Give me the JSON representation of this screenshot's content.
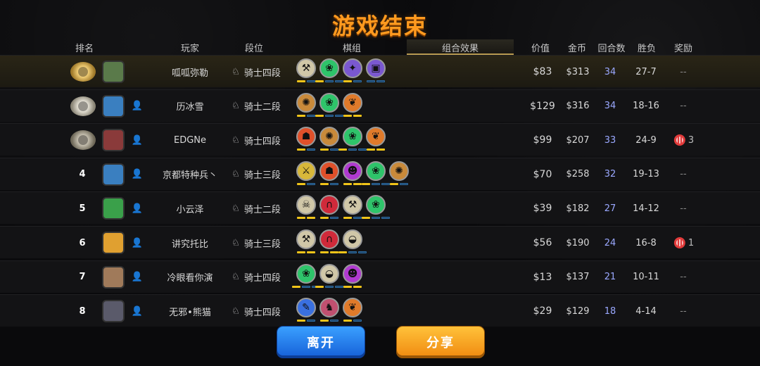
{
  "title": "游戏结束",
  "headers": {
    "rank": "排名",
    "player": "玩家",
    "tier": "段位",
    "comp": "棋组",
    "synergy": "组合效果",
    "value": "价值",
    "gold": "金币",
    "rounds": "回合数",
    "winloss": "胜负",
    "reward": "奖励"
  },
  "colors": {
    "title": "#ff9a1f",
    "active_tab_underline": "#b89a50",
    "rounds_text": "#9aa8ff",
    "leave_button": "#1660d8",
    "share_button": "#f08a10"
  },
  "rows": [
    {
      "rank": "",
      "medal": "gold",
      "avatar_color": "#5a7a4a",
      "add_friend": false,
      "name": "呱呱弥勒",
      "tier": "骑士四段",
      "value": "$83",
      "gold": "$313",
      "rounds": "34",
      "wl": "27-7",
      "reward": "--",
      "reward_count": "",
      "traits": [
        {
          "icon": "axe-icon",
          "color": "#d0c7a8",
          "bars": [
            1,
            0
          ]
        },
        {
          "icon": "paw-icon",
          "color": "#2ec46a",
          "bars": [
            1,
            0,
            0
          ]
        },
        {
          "icon": "fish-icon",
          "color": "#7a58d0",
          "bars": [
            1,
            0
          ]
        },
        {
          "icon": "tablet-icon",
          "color": "#7a58d0",
          "bars": [
            0,
            0
          ]
        }
      ]
    },
    {
      "rank": "",
      "medal": "silver",
      "avatar_color": "#3a7fc0",
      "add_friend": true,
      "name": "历冰雪",
      "tier": "骑士二段",
      "value": "$129",
      "gold": "$316",
      "rounds": "34",
      "wl": "18-16",
      "reward": "--",
      "reward_count": "",
      "traits": [
        {
          "icon": "gear-icon",
          "color": "#c98a3a",
          "bars": [
            1,
            0
          ]
        },
        {
          "icon": "paw-icon",
          "color": "#2ec46a",
          "bars": [
            1,
            0,
            0
          ]
        },
        {
          "icon": "leaf-icon",
          "color": "#e07a2a",
          "bars": [
            1,
            1
          ]
        }
      ]
    },
    {
      "rank": "",
      "medal": "bronze",
      "avatar_color": "#8a3a3a",
      "add_friend": true,
      "name": "EDGNe",
      "tier": "骑士四段",
      "value": "$99",
      "gold": "$207",
      "rounds": "33",
      "wl": "24-9",
      "reward": "",
      "reward_count": "3",
      "traits": [
        {
          "icon": "demon-icon",
          "color": "#e0502a",
          "bars": [
            1,
            0
          ]
        },
        {
          "icon": "gear-icon",
          "color": "#c98a3a",
          "bars": [
            1,
            0
          ]
        },
        {
          "icon": "paw-icon",
          "color": "#2ec46a",
          "bars": [
            1,
            0,
            0
          ]
        },
        {
          "icon": "leaf-icon",
          "color": "#e07a2a",
          "bars": [
            1,
            1
          ]
        }
      ]
    },
    {
      "rank": "4",
      "medal": "",
      "avatar_color": "#3a7fc0",
      "add_friend": true,
      "name": "京都特种兵丶",
      "tier": "骑士三段",
      "value": "$70",
      "gold": "$258",
      "rounds": "32",
      "wl": "19-13",
      "reward": "--",
      "reward_count": "",
      "traits": [
        {
          "icon": "swords-icon",
          "color": "#d8b83a",
          "bars": [
            1,
            0
          ]
        },
        {
          "icon": "demon-icon",
          "color": "#e0502a",
          "bars": [
            1,
            0
          ]
        },
        {
          "icon": "imp-icon",
          "color": "#b03ad0",
          "bars": [
            1,
            1
          ]
        },
        {
          "icon": "paw-icon",
          "color": "#2ec46a",
          "bars": [
            1,
            0,
            0
          ]
        },
        {
          "icon": "gear-icon",
          "color": "#c98a3a",
          "bars": [
            1,
            0
          ]
        }
      ]
    },
    {
      "rank": "5",
      "medal": "",
      "avatar_color": "#3aa04a",
      "add_friend": true,
      "name": "小云泽",
      "tier": "骑士二段",
      "value": "$39",
      "gold": "$182",
      "rounds": "27",
      "wl": "14-12",
      "reward": "--",
      "reward_count": "",
      "traits": [
        {
          "icon": "skull-icon",
          "color": "#d0c7a8",
          "bars": [
            1,
            1
          ]
        },
        {
          "icon": "arch-icon",
          "color": "#d02a3a",
          "bars": [
            1,
            0
          ]
        },
        {
          "icon": "axe-icon",
          "color": "#d0c7a8",
          "bars": [
            1,
            0
          ]
        },
        {
          "icon": "paw-icon",
          "color": "#2ec46a",
          "bars": [
            1,
            0,
            0
          ]
        }
      ]
    },
    {
      "rank": "6",
      "medal": "",
      "avatar_color": "#e0a030",
      "add_friend": true,
      "name": "讲究托比",
      "tier": "骑士三段",
      "value": "$56",
      "gold": "$190",
      "rounds": "24",
      "wl": "16-8",
      "reward": "",
      "reward_count": "1",
      "traits": [
        {
          "icon": "axe-icon",
          "color": "#d0c7a8",
          "bars": [
            1,
            1
          ]
        },
        {
          "icon": "arch-icon",
          "color": "#d02a3a",
          "bars": [
            1,
            1
          ]
        },
        {
          "icon": "helmet-icon",
          "color": "#d0c7a8",
          "bars": [
            1,
            0,
            0
          ]
        }
      ]
    },
    {
      "rank": "7",
      "medal": "",
      "avatar_color": "#a07a5a",
      "add_friend": true,
      "name": "冷眼看你演",
      "tier": "骑士四段",
      "value": "$13",
      "gold": "$137",
      "rounds": "21",
      "wl": "10-11",
      "reward": "--",
      "reward_count": "",
      "traits": [
        {
          "icon": "paw-icon",
          "color": "#2ec46a",
          "bars": [
            1,
            0,
            0
          ]
        },
        {
          "icon": "helmet-icon",
          "color": "#d0c7a8",
          "bars": [
            1,
            0,
            0
          ]
        },
        {
          "icon": "imp-icon",
          "color": "#b03ad0",
          "bars": [
            1,
            1
          ]
        }
      ]
    },
    {
      "rank": "8",
      "medal": "",
      "avatar_color": "#5a5a6a",
      "add_friend": true,
      "name": "无邪•熊猫",
      "tier": "骑士四段",
      "value": "$29",
      "gold": "$129",
      "rounds": "18",
      "wl": "4-14",
      "reward": "--",
      "reward_count": "",
      "traits": [
        {
          "icon": "feather-icon",
          "color": "#3a70e0",
          "bars": [
            1,
            0
          ]
        },
        {
          "icon": "knight-icon",
          "color": "#c05070",
          "bars": [
            1,
            0
          ]
        },
        {
          "icon": "leaf-icon",
          "color": "#e07a2a",
          "bars": [
            1,
            0
          ]
        }
      ]
    }
  ],
  "buttons": {
    "leave": "离开",
    "share": "分享"
  }
}
